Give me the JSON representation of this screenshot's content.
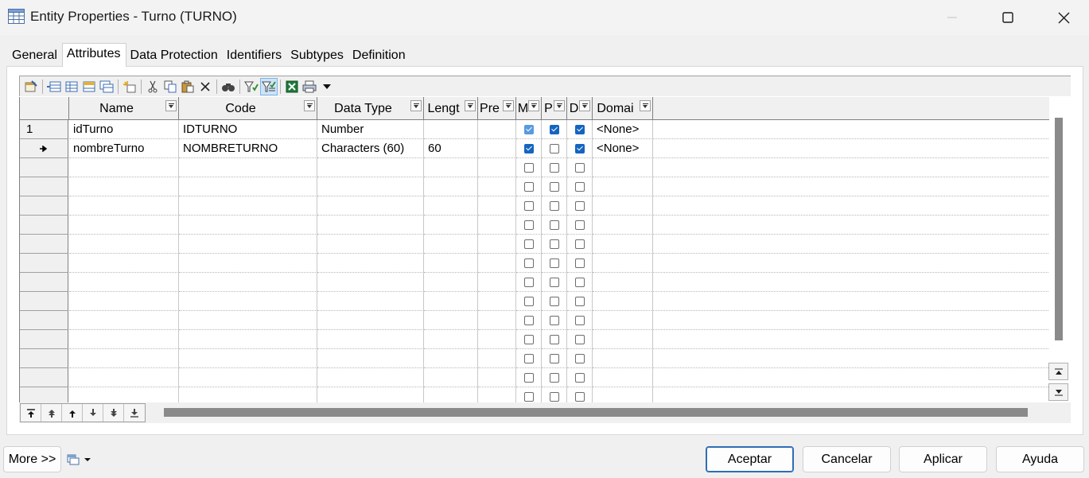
{
  "window": {
    "title": "Entity Properties - Turno (TURNO)"
  },
  "tabs": [
    {
      "label": "General"
    },
    {
      "label": "Attributes",
      "active": true
    },
    {
      "label": "Data Protection"
    },
    {
      "label": "Identifiers"
    },
    {
      "label": "Subtypes"
    },
    {
      "label": "Definition"
    }
  ],
  "toolbar": {
    "icons": [
      "properties-icon",
      "add-row-icon",
      "insert-row-icon",
      "add-attributes-icon",
      "reuse-attributes-icon",
      "new-domain-icon",
      "cut-icon",
      "copy-icon",
      "paste-icon",
      "delete-icon",
      "find-icon",
      "filter-icon",
      "filter-active-icon",
      "excel-icon",
      "print-icon",
      "dropdown-icon"
    ]
  },
  "grid": {
    "columns": [
      {
        "label": "Name"
      },
      {
        "label": "Code"
      },
      {
        "label": "Data Type"
      },
      {
        "label": "Lengt"
      },
      {
        "label": "Pre"
      },
      {
        "label": "M"
      },
      {
        "label": "P"
      },
      {
        "label": "D"
      },
      {
        "label": "Domai"
      }
    ],
    "rows": [
      {
        "header": "1",
        "name": "idTurno",
        "code": "IDTURNO",
        "data_type": "Number",
        "length": "",
        "precision": "",
        "mandatory": true,
        "primary": true,
        "displayed": true,
        "domain": "<None>"
      },
      {
        "header": "→",
        "name": "nombreTurno",
        "code": "NOMBRETURNO",
        "data_type": "Characters (60)",
        "length": "60",
        "precision": "",
        "mandatory": true,
        "primary": false,
        "displayed": true,
        "domain": "<None>"
      }
    ],
    "empty_rows": 13
  },
  "footer": {
    "more_label": "More >>",
    "ok_label": "Aceptar",
    "cancel_label": "Cancelar",
    "apply_label": "Aplicar",
    "help_label": "Ayuda"
  },
  "colors": {
    "checkbox_checked": "#1565c0",
    "default_button_border": "#2f6db5"
  }
}
